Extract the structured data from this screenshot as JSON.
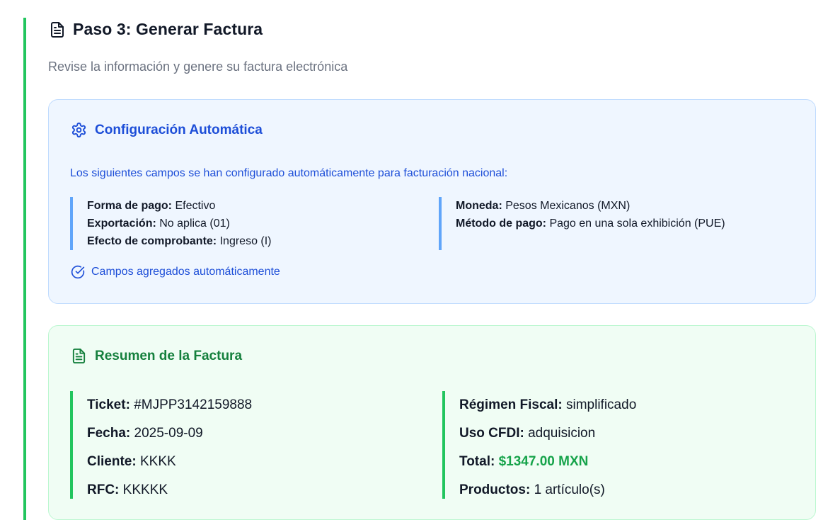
{
  "step": {
    "title": "Paso 3: Generar Factura",
    "subtitle": "Revise la información y genere su factura electrónica",
    "icon": "document-icon"
  },
  "auto_config": {
    "title": "Configuración Automática",
    "icon": "gear-icon",
    "note": "Los siguientes campos se han configurado automáticamente para facturación nacional:",
    "left_fields": [
      {
        "label": "Forma de pago:",
        "value": "Efectivo"
      },
      {
        "label": "Exportación:",
        "value": "No aplica (01)"
      },
      {
        "label": "Efecto de comprobante:",
        "value": "Ingreso (I)"
      }
    ],
    "right_fields": [
      {
        "label": "Moneda:",
        "value": "Pesos Mexicanos (MXN)"
      },
      {
        "label": "Método de pago:",
        "value": "Pago en una sola exhibición (PUE)"
      }
    ],
    "confirm_text": "Campos agregados automáticamente",
    "confirm_icon": "check-circle-icon",
    "accent_color": "#1d4ed8"
  },
  "summary": {
    "title": "Resumen de la Factura",
    "icon": "document-icon",
    "left_fields": [
      {
        "label": "Ticket:",
        "value": "#MJPP3142159888"
      },
      {
        "label": "Fecha:",
        "value": "2025-09-09"
      },
      {
        "label": "Cliente:",
        "value": "KKKK"
      },
      {
        "label": "RFC:",
        "value": "KKKKK"
      }
    ],
    "right_fields": [
      {
        "label": "Régimen Fiscal:",
        "value": "simplificado"
      },
      {
        "label": "Uso CFDI:",
        "value": "adquisicion"
      },
      {
        "label": "Total:",
        "value": "$1347.00 MXN"
      },
      {
        "label": "Productos:",
        "value": "1 artículo(s)"
      }
    ],
    "accent_color": "#15803d"
  }
}
